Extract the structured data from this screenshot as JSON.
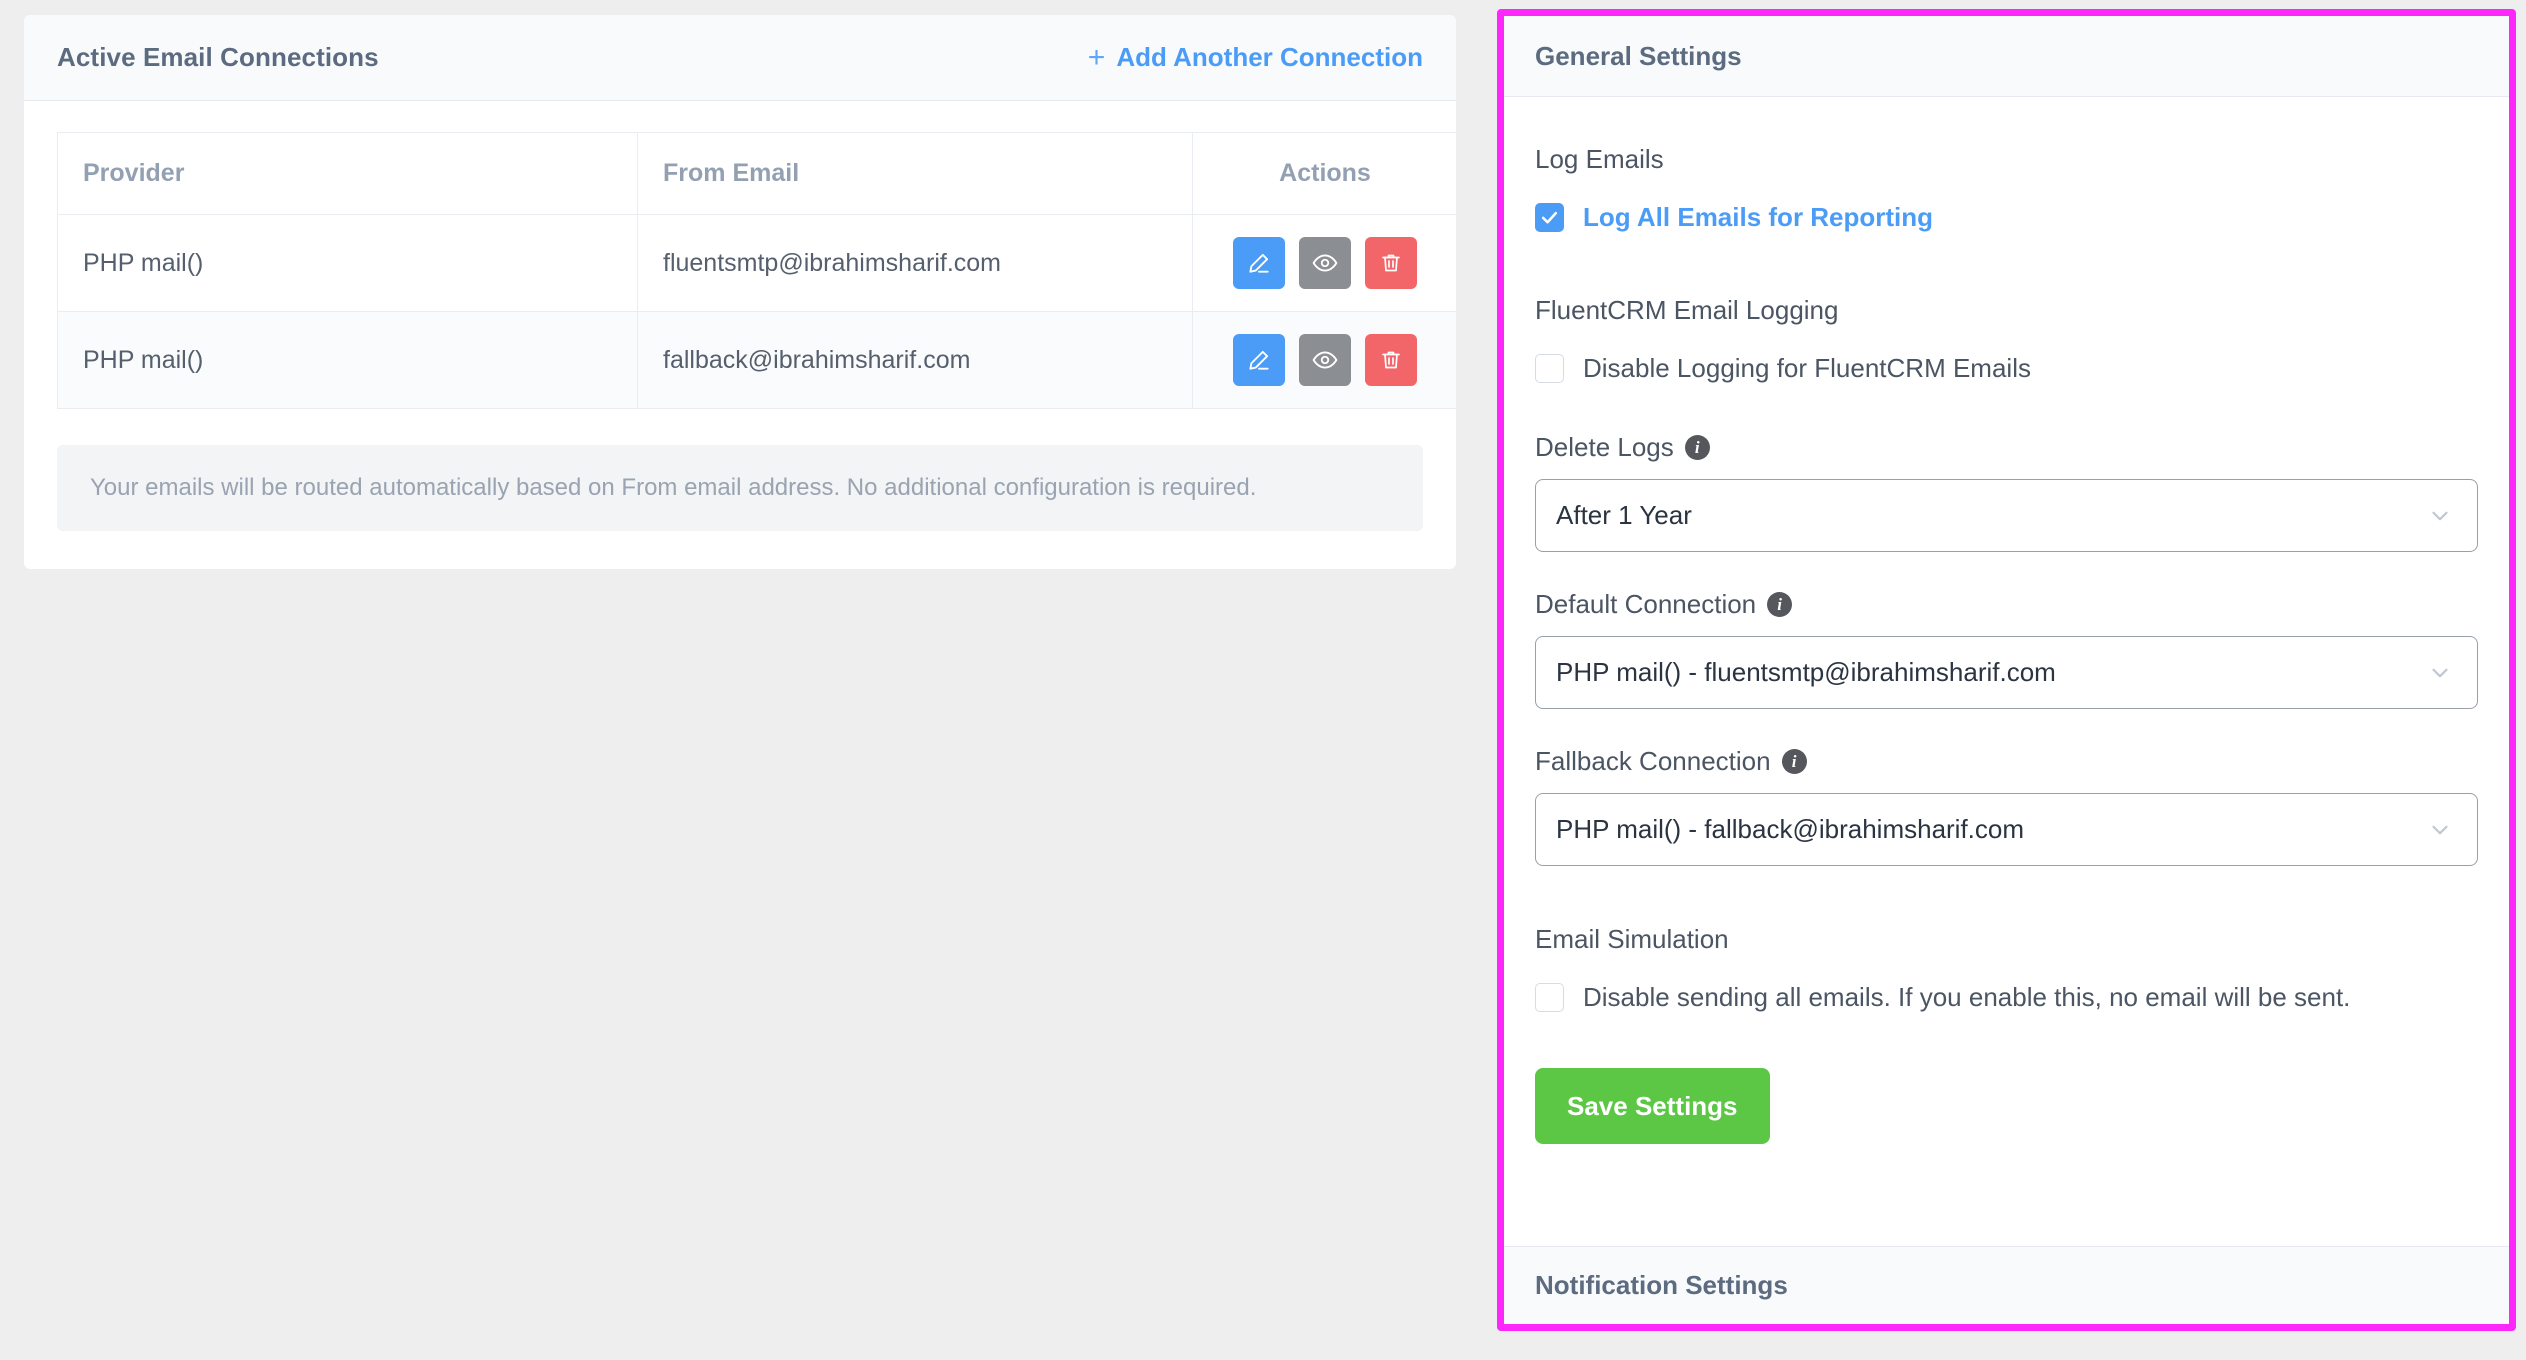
{
  "connections_card": {
    "title": "Active Email Connections",
    "add_link_label": "Add Another Connection",
    "add_link_icon": "plus-icon",
    "table": {
      "columns": [
        "Provider",
        "From Email",
        "Actions"
      ],
      "rows": [
        {
          "provider": "PHP mail()",
          "from_email": "fluentsmtp@ibrahimsharif.com",
          "actions": [
            "edit-icon",
            "eye-icon",
            "trash-icon"
          ]
        },
        {
          "provider": "PHP mail()",
          "from_email": "fallback@ibrahimsharif.com",
          "actions": [
            "edit-icon",
            "eye-icon",
            "trash-icon"
          ]
        }
      ]
    },
    "notice": "Your emails will be routed automatically based on From email address. No additional configuration is required."
  },
  "settings_panel": {
    "header_title": "General Settings",
    "footer_title": "Notification Settings",
    "log_emails": {
      "label": "Log Emails",
      "checkbox_label": "Log All Emails for Reporting",
      "checked": true
    },
    "fluentcrm_logging": {
      "label": "FluentCRM Email Logging",
      "checkbox_label": "Disable Logging for FluentCRM Emails",
      "checked": false
    },
    "delete_logs": {
      "label": "Delete Logs",
      "info_icon": "info-icon",
      "value": "After 1 Year",
      "options": [
        "After 1 Year"
      ]
    },
    "default_connection": {
      "label": "Default Connection",
      "info_icon": "info-icon",
      "value": "PHP mail() - fluentsmtp@ibrahimsharif.com",
      "options": [
        "PHP mail() - fluentsmtp@ibrahimsharif.com"
      ]
    },
    "fallback_connection": {
      "label": "Fallback Connection",
      "info_icon": "info-icon",
      "value": "PHP mail() - fallback@ibrahimsharif.com",
      "options": [
        "PHP mail() - fallback@ibrahimsharif.com"
      ]
    },
    "email_simulation": {
      "label": "Email Simulation",
      "checkbox_label": "Disable sending all emails. If you enable this, no email will be sent.",
      "checked": false
    },
    "save_button_label": "Save Settings"
  },
  "colors": {
    "accent_blue": "#4a9cf6",
    "save_green": "#5bc745",
    "delete_red": "#f2666a",
    "view_gray": "#8b8f94",
    "highlight_magenta": "#fb27fb",
    "header_bg": "#f8fafc",
    "page_bg": "#eeeeee"
  }
}
